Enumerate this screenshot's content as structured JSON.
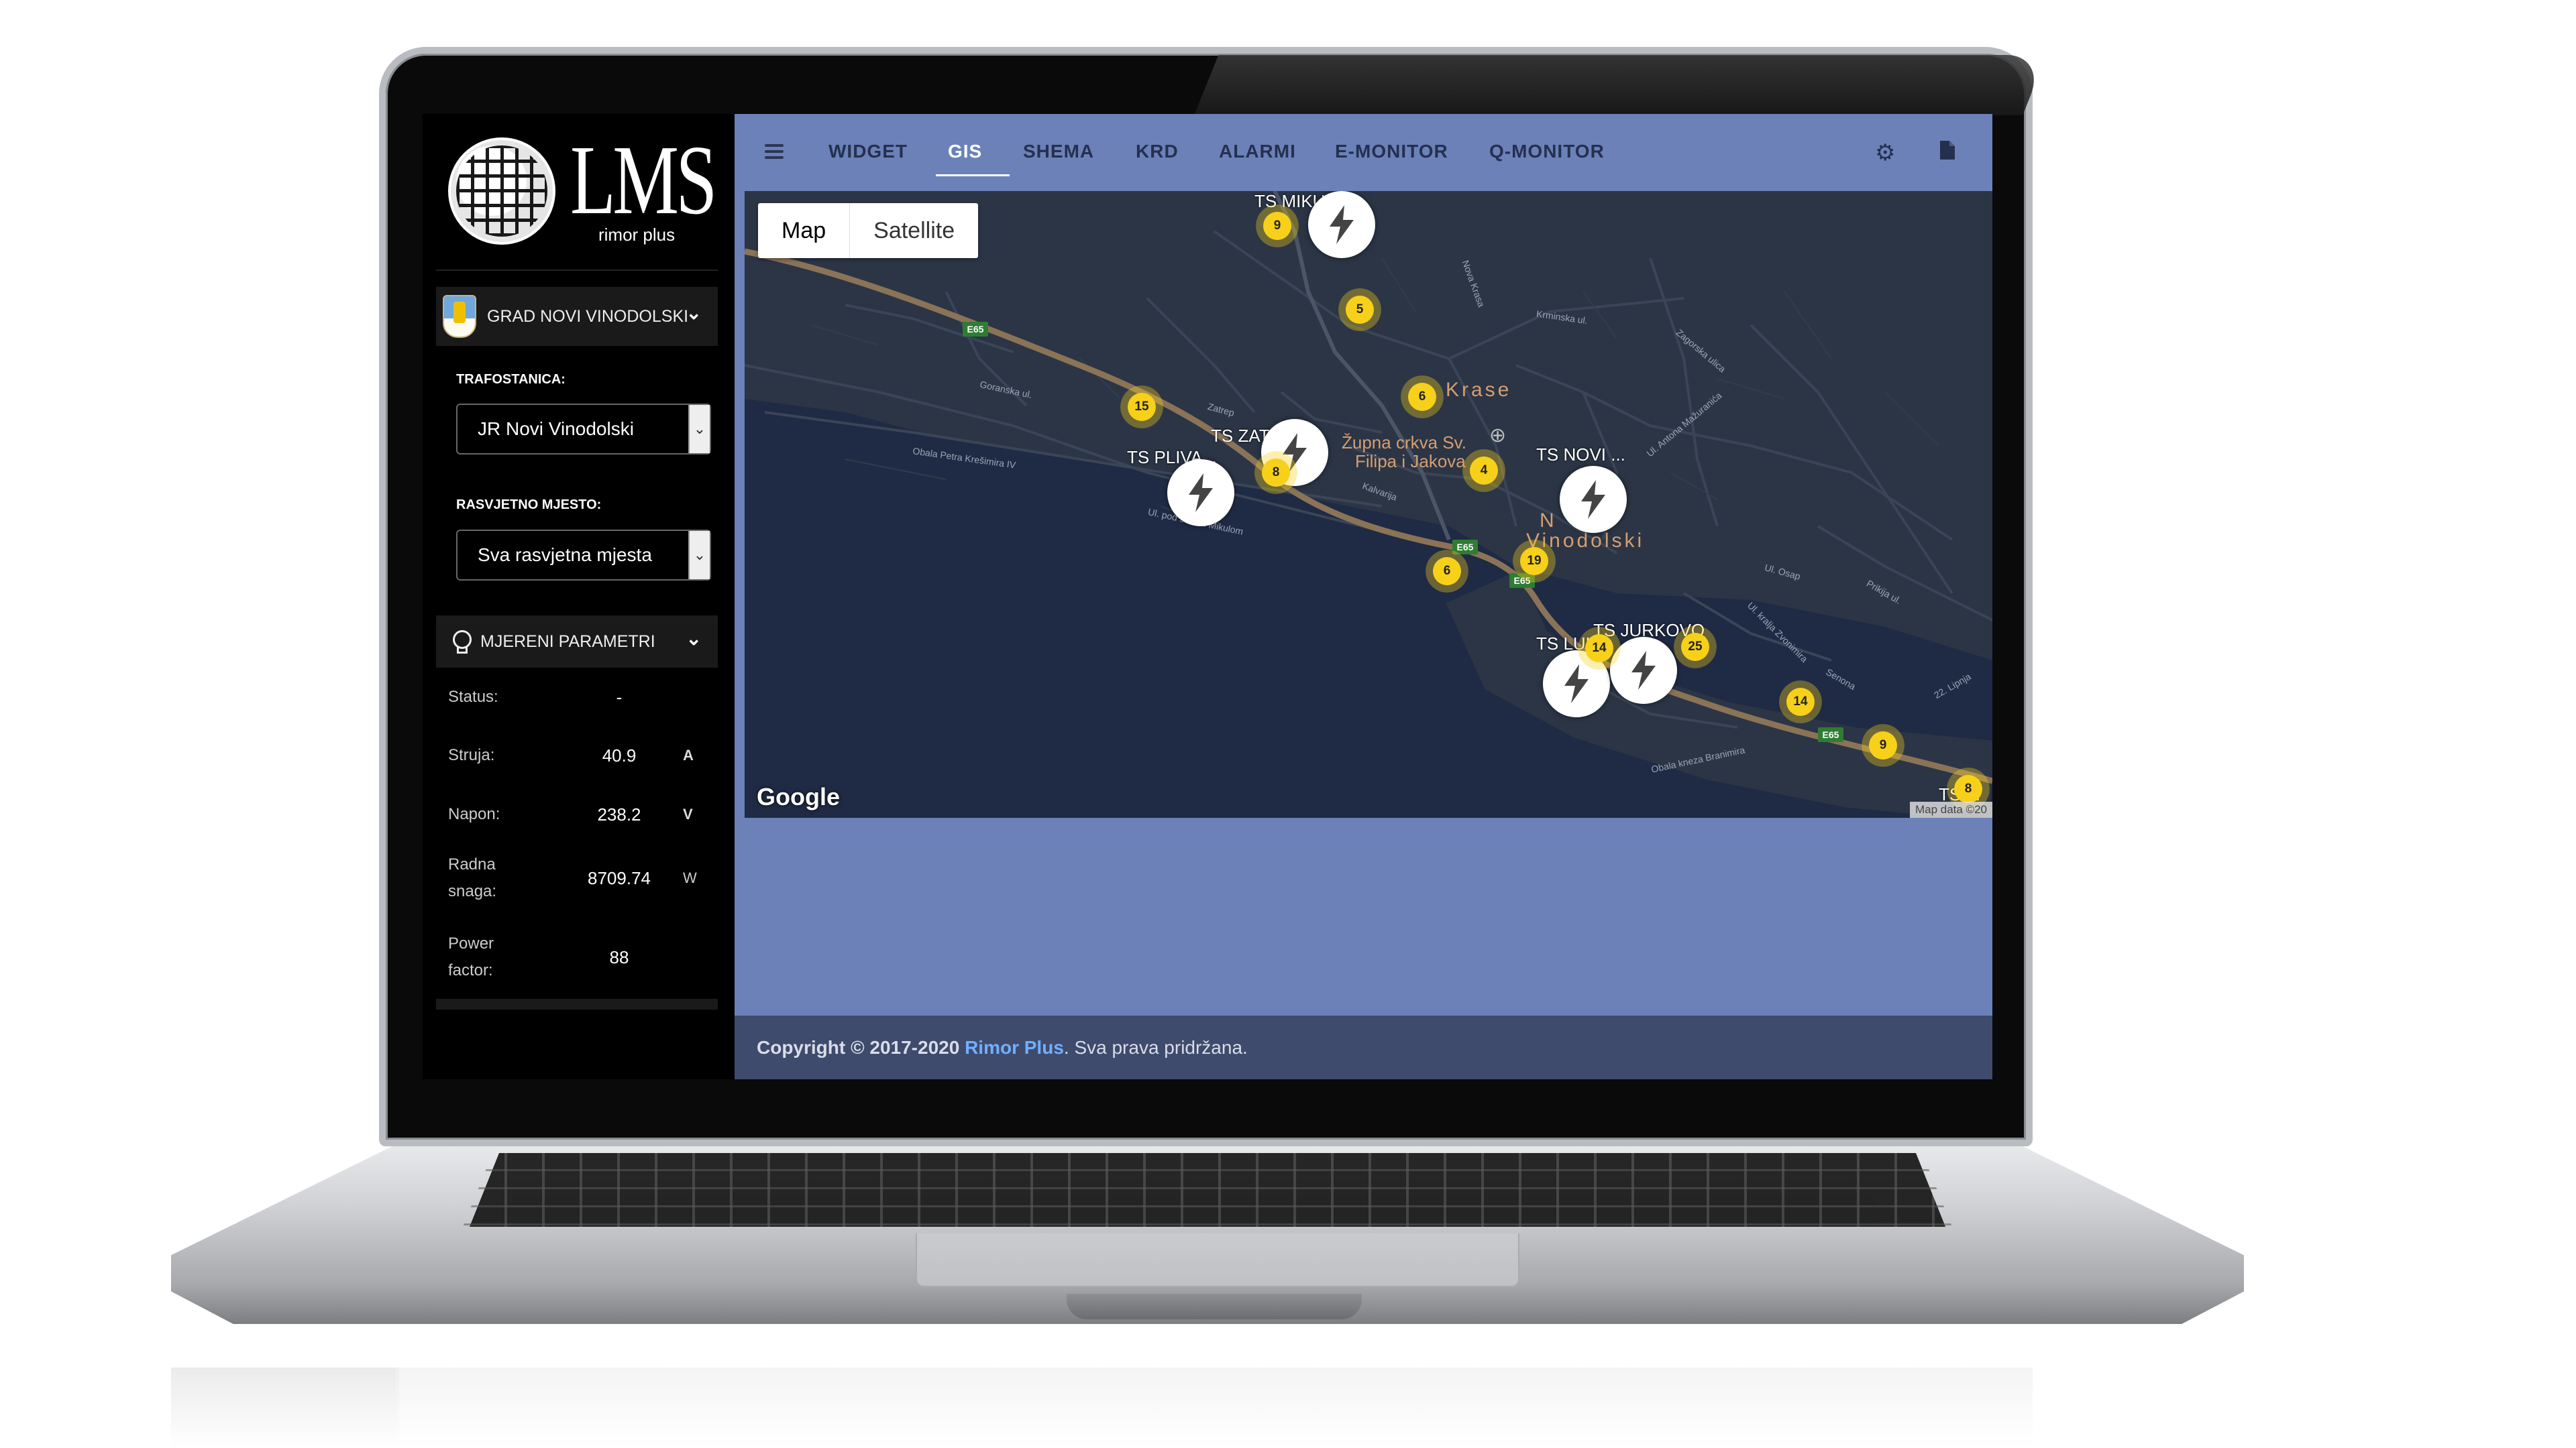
{
  "logo": {
    "name": "LMS",
    "subtitle": "rimor plus"
  },
  "sidebar": {
    "city": "GRAD NOVI VINODOLSKI",
    "trafostanica_label": "TRAFOSTANICA:",
    "trafostanica_value": "JR Novi Vinodolski",
    "rasvjetno_label": "RASVJETNO MJESTO:",
    "rasvjetno_value": "Sva rasvjetna mjesta",
    "params_header": "MJERENI PARAMETRI",
    "params": [
      {
        "name": "Status:",
        "value": "-",
        "unit": ""
      },
      {
        "name": "Struja:",
        "value": "40.9",
        "unit": "A"
      },
      {
        "name": "Napon:",
        "value": "238.2",
        "unit": "V"
      },
      {
        "name": "Radna snaga:",
        "value": "8709.74",
        "unit": "W"
      },
      {
        "name": "Power factor:",
        "value": "88",
        "unit": ""
      }
    ]
  },
  "nav": {
    "tabs": [
      "WIDGET",
      "GIS",
      "SHEMA",
      "KRD",
      "ALARMI",
      "E-MONITOR",
      "Q-MONITOR"
    ],
    "active": "GIS",
    "icons": [
      "gear-icon",
      "document-icon"
    ]
  },
  "map": {
    "map_type_buttons": [
      "Map",
      "Satellite"
    ],
    "google_logo": "Google",
    "attribution": "Map data ©20",
    "substations": [
      "TS MIKUL...",
      "TS ZATREP",
      "TS PLIVA...",
      "TS NOVI ...",
      "TS LUK...",
      "TS JURKOVO",
      "TS ..."
    ],
    "clusters": [
      "9",
      "5",
      "6",
      "15",
      "8",
      "4",
      "6",
      "19",
      "14",
      "25",
      "14",
      "9",
      "8"
    ],
    "town": "Novi Vinodolski",
    "town_part1": "N",
    "town_part2": "Vinodolski",
    "area": "Krase",
    "poi_line1": "Župna crkva Sv.",
    "poi_line2": "Filipa i Jakova",
    "streets": [
      "Goranska ul.",
      "Obala Petra Krešimira IV",
      "Ul. pod svetim Mikulom",
      "Zatrep",
      "Kalvarija",
      "Krminska ul.",
      "Zagorska ulica",
      "Ul. Antona Mažuranića",
      "Nova Krasa",
      "Obala kneza Branimira",
      "Ul. Osap",
      "Ul. kralja Zvonimira",
      "Prikija ul.",
      "Senona",
      "22. Lipnja"
    ],
    "road_shield": "E65"
  },
  "footer": {
    "prefix": "Copyright © 2017-2020 ",
    "brand": "Rimor Plus",
    "suffix": ". Sva prava pridržana."
  }
}
